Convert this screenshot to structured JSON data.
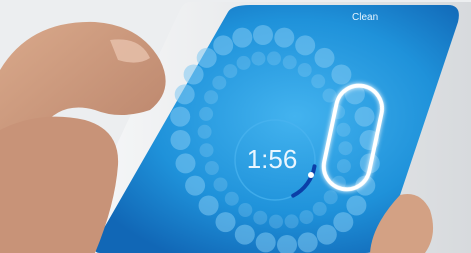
{
  "app": {
    "status_label": "Clean",
    "timer": "1:56",
    "timer_progress": 0.15,
    "accent_color": "#1b7fd0",
    "screen_color": "#1e90d8",
    "highlight_color": "#ffffff",
    "progress_color": "#0b3fa8"
  },
  "teeth": {
    "upper_count": 14,
    "lower_count": 14,
    "highlighted_zone": "upper-right-molars"
  }
}
